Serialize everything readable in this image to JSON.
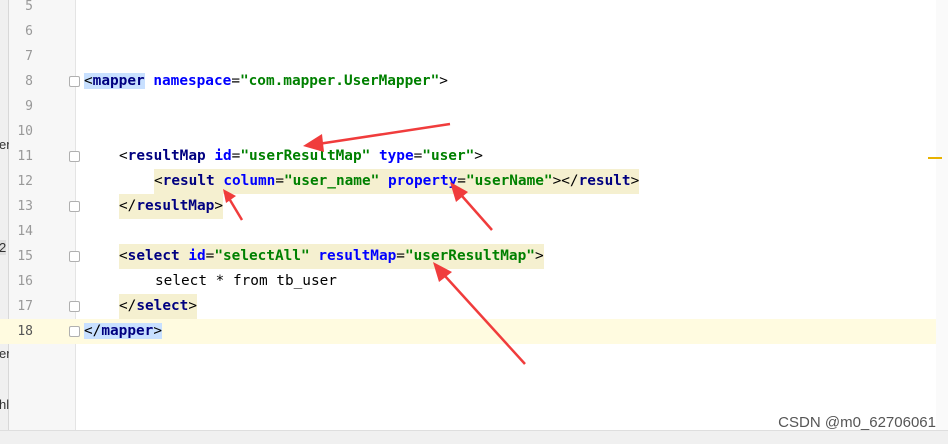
{
  "editor": {
    "line_numbers": [
      "5",
      "6",
      "7",
      "8",
      "9",
      "10",
      "11",
      "12",
      "13",
      "14",
      "15",
      "16",
      "17",
      "18"
    ],
    "lines": {
      "l8": {
        "open": "<",
        "tag": "mapper",
        "attr1": "namespace",
        "eq1": "=",
        "val1": "\"com.mapper.UserMapper\"",
        "close": ">"
      },
      "l11": {
        "open": "<",
        "tag": "resultMap",
        "attr1": "id",
        "eq1": "=",
        "val1": "\"userResultMap\"",
        "attr2": "type",
        "eq2": "=",
        "val2": "\"user\"",
        "close": ">"
      },
      "l12": {
        "open": "<",
        "tag": "result",
        "attr1": "column",
        "eq1": "=",
        "val1": "\"user_name\"",
        "attr2": "property",
        "eq2": "=",
        "val2": "\"userName\"",
        "close": "></",
        "endtag": "result",
        "close2": ">"
      },
      "l13": {
        "open": "</",
        "tag": "resultMap",
        "close": ">"
      },
      "l15": {
        "open": "<",
        "tag": "select",
        "attr1": "id",
        "eq1": "=",
        "val1": "\"selectAll\"",
        "attr2": "resultMap",
        "eq2": "=",
        "val2": "\"userResultMap\"",
        "close": ">"
      },
      "l16": {
        "text": "select * from tb_user"
      },
      "l17": {
        "open": "</",
        "tag": "select",
        "close": ">"
      },
      "l18": {
        "open": "</",
        "tag": "mapper",
        "close": ">"
      }
    },
    "left_fragments": [
      "er",
      "2",
      "er",
      "hl"
    ],
    "arrow_color": "#f03c3c",
    "marker_color": "#e8b200"
  },
  "watermark": "CSDN @m0_62706061"
}
